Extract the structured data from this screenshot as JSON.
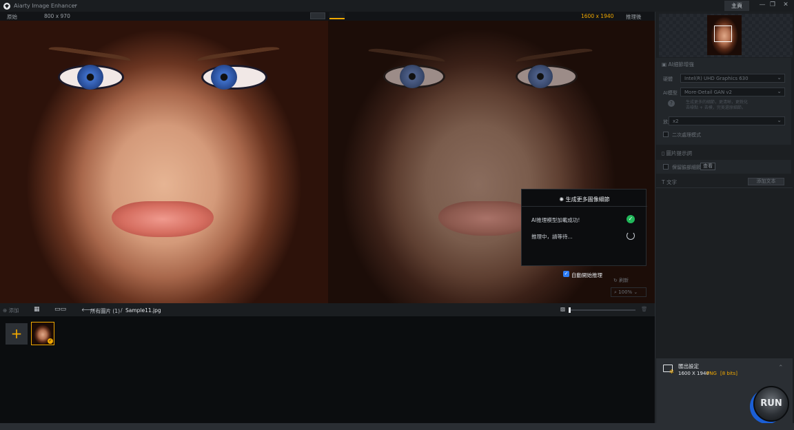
{
  "app": {
    "title": "Aiarty Image Enhancer",
    "main_tab": "主頁"
  },
  "view": {
    "original_label": "原始",
    "original_size": "800 x 970",
    "output_size": "1600 x 1940",
    "after_label": "推理後"
  },
  "dialog": {
    "title": "生成更多圖像細節",
    "row1": "AI推理模型加載成功!",
    "row2": "推理中，請等待...",
    "auto_label": "自動開始推理",
    "refresh_label": "刷新",
    "zoom": "100%"
  },
  "bottombar": {
    "add_label": "添加",
    "all_images": "所有圖片 (1)",
    "separator": "/",
    "filename": "Sample11.jpg"
  },
  "rightpanel": {
    "ai_section": "AI細節增強",
    "device_label": "硬體",
    "device_value": "Intel(R) UHD Graphics 630",
    "model_label": "AI模型",
    "model_value": "More-Detail GAN v2",
    "model_desc1": "生成更多的細節，更清晰，更銳化",
    "model_desc2": "去噪點 + 去模，完美還原細節。",
    "scale_label": "放大",
    "scale_value": "x2",
    "second_pass": "二次處理模式",
    "prompt_section": "圖片提示詞",
    "keep_label": "保留臉部細節",
    "keep_btn": "查看",
    "text_label": "文字",
    "add_text_btn": "添加文本"
  },
  "output": {
    "title": "匯出設定",
    "size": "1600 X 1940",
    "format": "PNG",
    "bits": "[8 bits]"
  },
  "run_label": "RUN"
}
